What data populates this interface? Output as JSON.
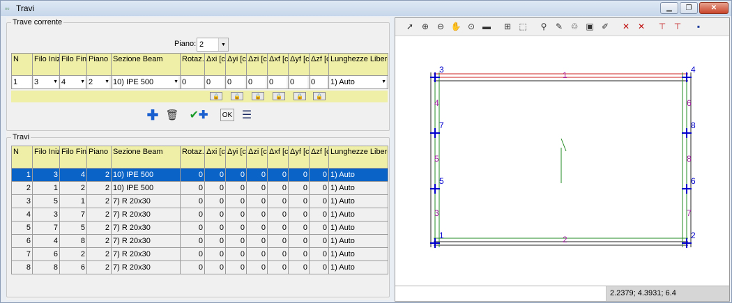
{
  "window": {
    "title": "Travi"
  },
  "current": {
    "group_label": "Trave corrente",
    "piano_label": "Piano:",
    "piano_value": "2",
    "headers": [
      "N",
      "Filo Iniziale",
      "Filo Finale",
      "Piano Finale",
      "Sezione Beam",
      "Rotaz. [°]",
      "Δxi [cm]",
      "Δyi [cm]",
      "Δzi [cm]",
      "Δxf [cm]",
      "Δyf [cm]",
      "Δzf [cm]",
      "Lunghezze Libere"
    ],
    "row": {
      "n": "1",
      "filo_iniziale": "3",
      "filo_finale": "4",
      "piano_finale": "2",
      "sezione": "10) IPE 500",
      "rotaz": "0",
      "dxi": "0",
      "dyi": "0",
      "dzi": "0",
      "dxf": "0",
      "dyf": "0",
      "dzf": "0",
      "lunghezze": "1) Auto"
    },
    "ok_label": "OK"
  },
  "list": {
    "group_label": "Travi",
    "rows": [
      [
        "1",
        "3",
        "4",
        "2",
        "10) IPE 500",
        "0",
        "0",
        "0",
        "0",
        "0",
        "0",
        "0",
        "1) Auto"
      ],
      [
        "2",
        "1",
        "2",
        "2",
        "10) IPE 500",
        "0",
        "0",
        "0",
        "0",
        "0",
        "0",
        "0",
        "1) Auto"
      ],
      [
        "3",
        "5",
        "1",
        "2",
        "7) R 20x30",
        "0",
        "0",
        "0",
        "0",
        "0",
        "0",
        "0",
        "1) Auto"
      ],
      [
        "4",
        "3",
        "7",
        "2",
        "7) R 20x30",
        "0",
        "0",
        "0",
        "0",
        "0",
        "0",
        "0",
        "1) Auto"
      ],
      [
        "5",
        "7",
        "5",
        "2",
        "7) R 20x30",
        "0",
        "0",
        "0",
        "0",
        "0",
        "0",
        "0",
        "1) Auto"
      ],
      [
        "6",
        "4",
        "8",
        "2",
        "7) R 20x30",
        "0",
        "0",
        "0",
        "0",
        "0",
        "0",
        "0",
        "1) Auto"
      ],
      [
        "7",
        "6",
        "2",
        "2",
        "7) R 20x30",
        "0",
        "0",
        "0",
        "0",
        "0",
        "0",
        "0",
        "1) Auto"
      ],
      [
        "8",
        "8",
        "6",
        "2",
        "7) R 20x30",
        "0",
        "0",
        "0",
        "0",
        "0",
        "0",
        "0",
        "1) Auto"
      ]
    ],
    "selected_index": 0
  },
  "drawing": {
    "node_labels": {
      "n1": "1",
      "n2": "2",
      "n3": "3",
      "n4": "4",
      "n5": "5",
      "n6": "6",
      "n7": "7",
      "n8": "8"
    },
    "beam_labels": {
      "b1": "1",
      "b2": "2",
      "b3": "3",
      "b4": "4",
      "b5": "5",
      "b6": "6",
      "b7": "7",
      "b8": "8"
    },
    "colors": {
      "beam_top": "#cc2222",
      "beam_side": "#228822",
      "node": "#0000cc",
      "label_node": "#0000cc",
      "label_beam": "#aa22aa"
    }
  },
  "status": {
    "coords": "2.2379; 4.3931; 6.4"
  },
  "toolbar_icons": [
    "select-icon",
    "zoom-in-icon",
    "zoom-out-icon",
    "pan-icon",
    "zoom-window-icon",
    "measure-icon",
    "zoom-extents-icon",
    "fit-icon",
    "node-icon",
    "paint-icon",
    "refresh-icon",
    "color-icon",
    "brush-icon",
    "ini-icon",
    "fin-icon",
    "beam-icon",
    "beam-alt-icon",
    "save-icon"
  ]
}
